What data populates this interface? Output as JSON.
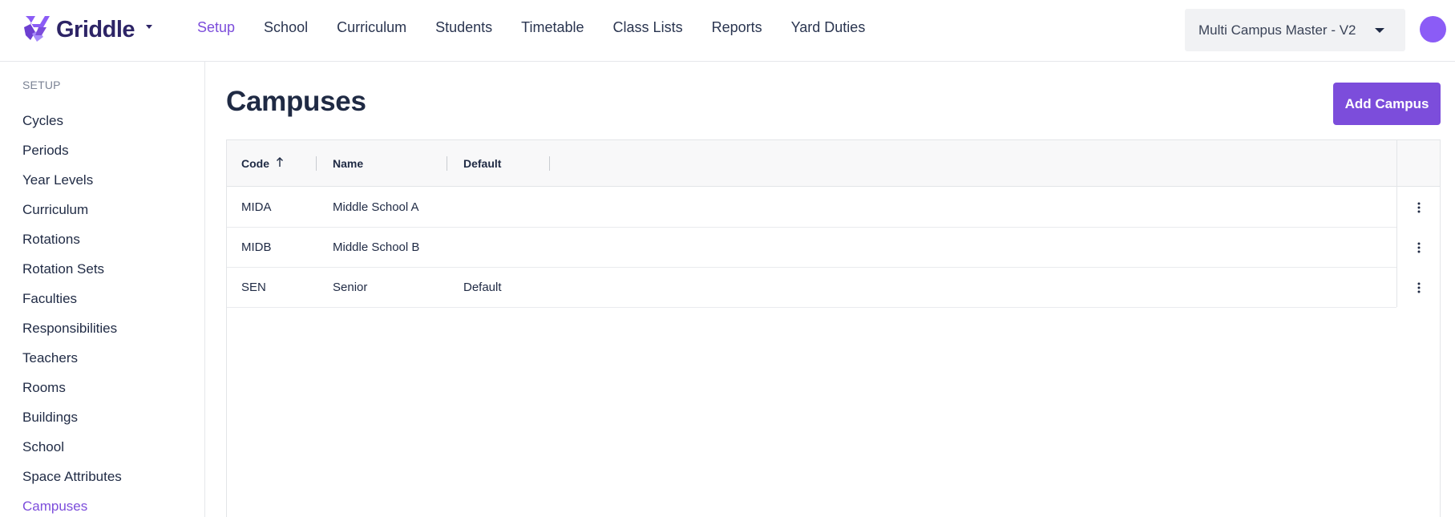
{
  "brand": {
    "name": "Griddle",
    "accent": "#7c4ddb",
    "logo_icon": "griddle-logo-icon"
  },
  "nav": {
    "items": [
      {
        "label": "Setup",
        "active": true
      },
      {
        "label": "School",
        "active": false
      },
      {
        "label": "Curriculum",
        "active": false
      },
      {
        "label": "Students",
        "active": false
      },
      {
        "label": "Timetable",
        "active": false
      },
      {
        "label": "Class Lists",
        "active": false
      },
      {
        "label": "Reports",
        "active": false
      },
      {
        "label": "Yard Duties",
        "active": false
      }
    ]
  },
  "campus_select": {
    "value": "Multi Campus Master - V2"
  },
  "avatar": {
    "color": "#8b5cf6"
  },
  "sidebar": {
    "heading": "SETUP",
    "items": [
      {
        "label": "Cycles"
      },
      {
        "label": "Periods"
      },
      {
        "label": "Year Levels"
      },
      {
        "label": "Curriculum"
      },
      {
        "label": "Rotations"
      },
      {
        "label": "Rotation Sets"
      },
      {
        "label": "Faculties"
      },
      {
        "label": "Responsibilities"
      },
      {
        "label": "Teachers"
      },
      {
        "label": "Rooms"
      },
      {
        "label": "Buildings"
      },
      {
        "label": "School"
      },
      {
        "label": "Space Attributes"
      },
      {
        "label": "Campuses"
      }
    ],
    "active_item": "Campuses"
  },
  "main": {
    "title": "Campuses",
    "add_button": "Add Campus",
    "table": {
      "columns": [
        "Code",
        "Name",
        "Default"
      ],
      "sort": {
        "column": "Code",
        "direction": "ascending",
        "icon": "arrow-up-icon"
      },
      "rows": [
        {
          "code": "MIDA",
          "name": "Middle School A",
          "default": ""
        },
        {
          "code": "MIDB",
          "name": "Middle School B",
          "default": ""
        },
        {
          "code": "SEN",
          "name": "Senior",
          "default": "Default"
        }
      ],
      "row_action_icon": "more-vertical-icon"
    }
  }
}
